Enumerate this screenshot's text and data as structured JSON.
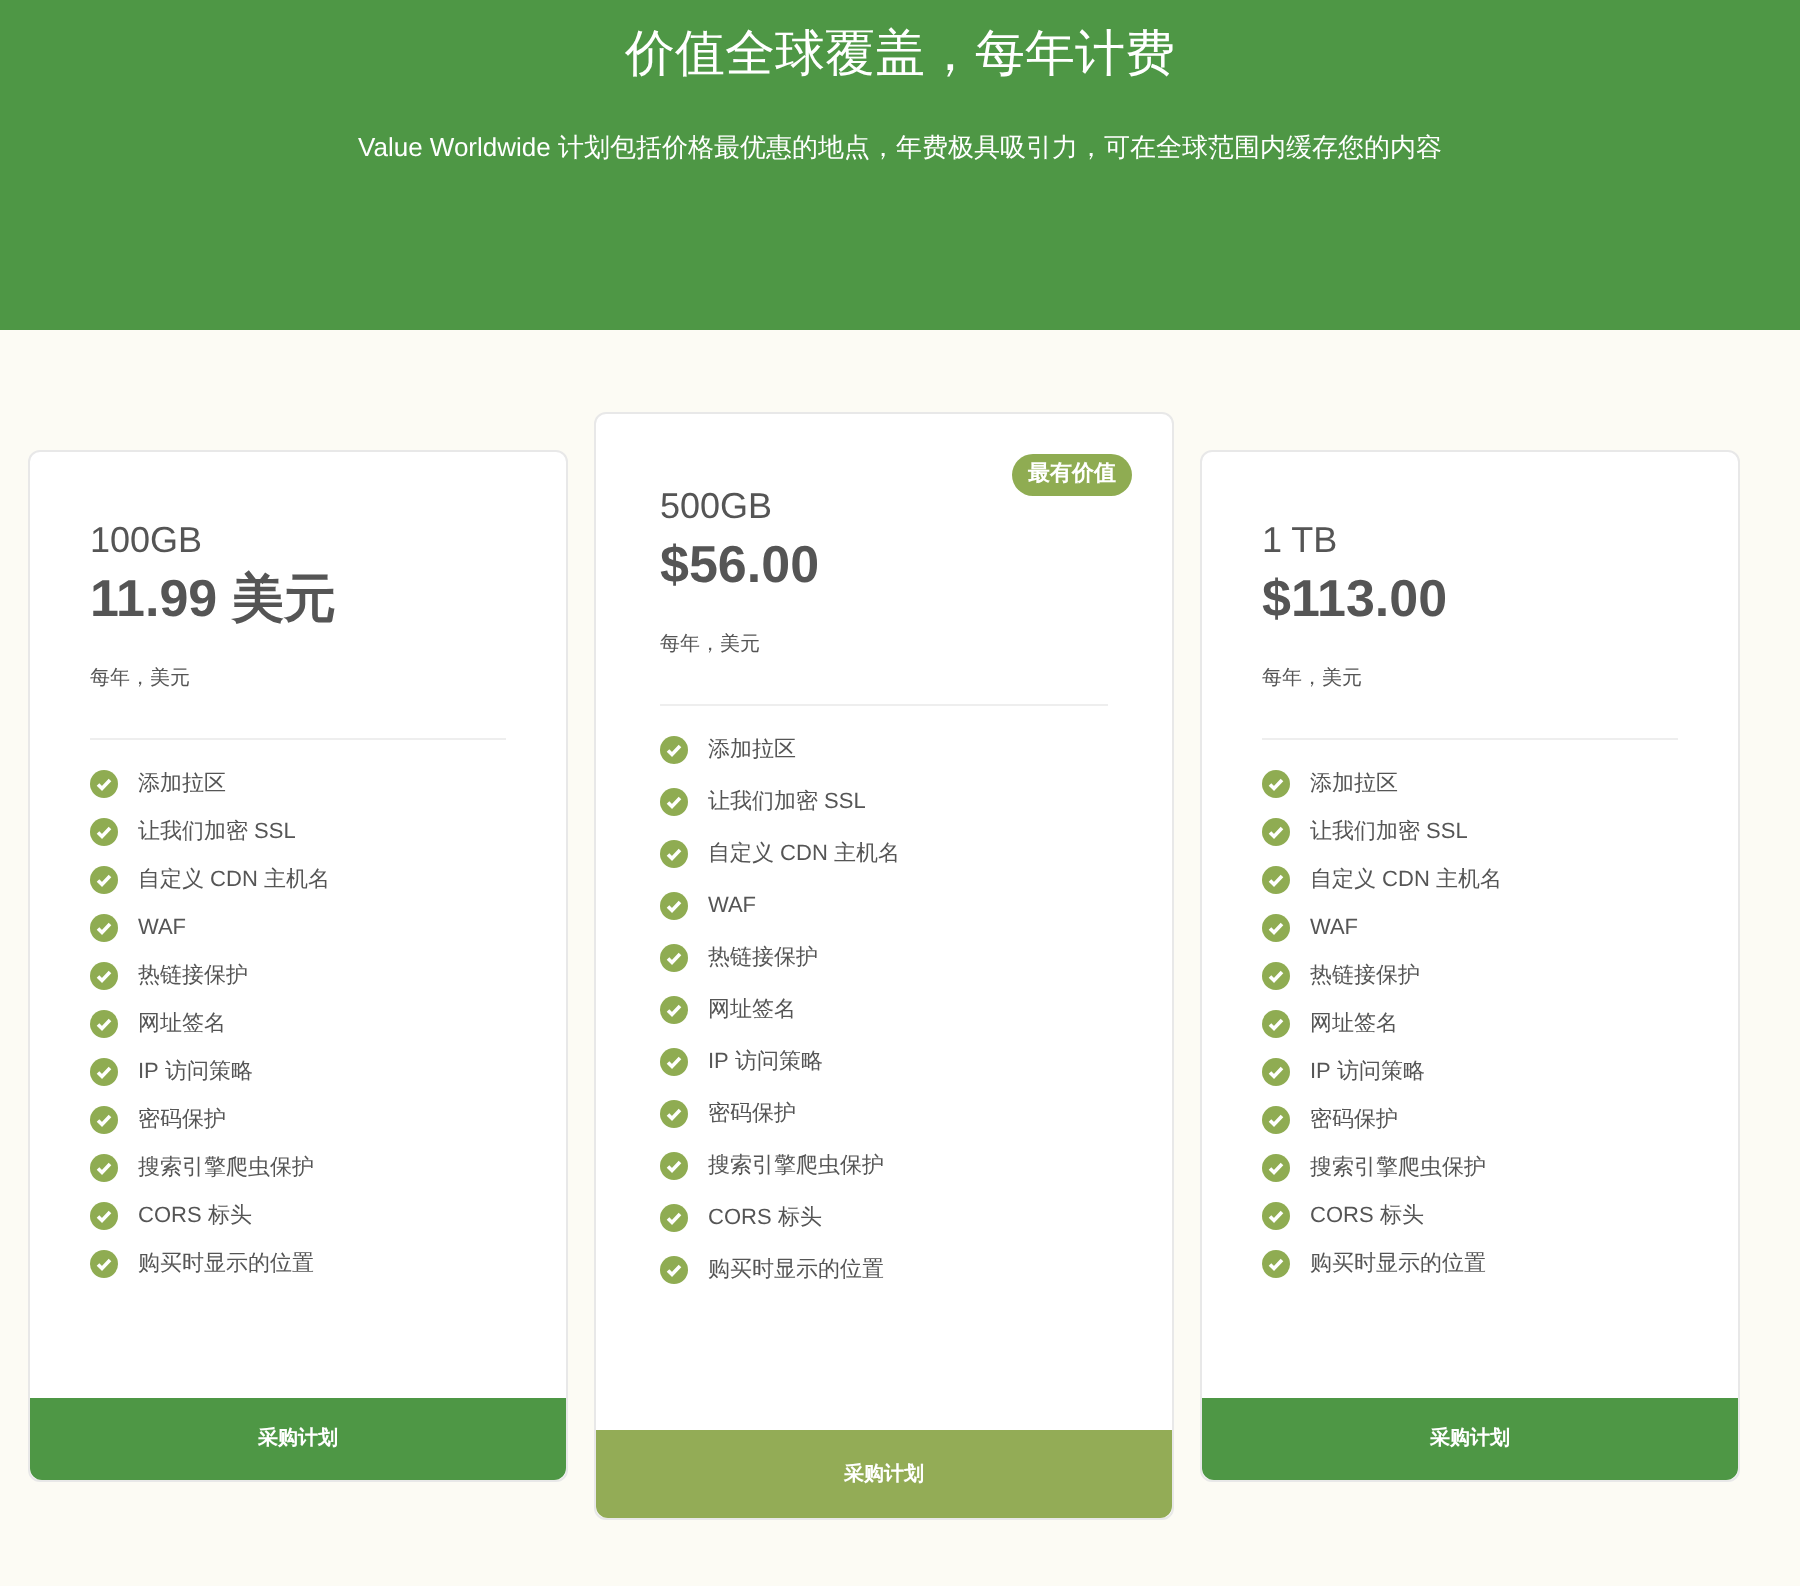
{
  "header": {
    "title": "价值全球覆盖，每年计费",
    "subtitle": "Value Worldwide 计划包括价格最优惠的地点，年费极具吸引力，可在全球范围内缓存您的内容"
  },
  "plans": [
    {
      "name": "100GB",
      "price": "11.99 美元",
      "period": "每年，美元",
      "featured": false,
      "features": [
        "添加拉区",
        "让我们加密 SSL",
        "自定义 CDN 主机名",
        "WAF",
        "热链接保护",
        "网址签名",
        "IP 访问策略",
        "密码保护",
        "搜索引擎爬虫保护",
        "CORS 标头",
        "购买时显示的位置"
      ],
      "button": "采购计划"
    },
    {
      "name": "500GB",
      "price": "$56.00",
      "period": "每年，美元",
      "featured": true,
      "badge": "最有价值",
      "features": [
        "添加拉区",
        "让我们加密 SSL",
        "自定义 CDN 主机名",
        "WAF",
        "热链接保护",
        "网址签名",
        "IP 访问策略",
        "密码保护",
        "搜索引擎爬虫保护",
        "CORS 标头",
        "购买时显示的位置"
      ],
      "button": "采购计划"
    },
    {
      "name": "1 TB",
      "price": "$113.00",
      "period": "每年，美元",
      "featured": false,
      "features": [
        "添加拉区",
        "让我们加密 SSL",
        "自定义 CDN 主机名",
        "WAF",
        "热链接保护",
        "网址签名",
        "IP 访问策略",
        "密码保护",
        "搜索引擎爬虫保护",
        "CORS 标头",
        "购买时显示的位置"
      ],
      "button": "采购计划"
    }
  ]
}
